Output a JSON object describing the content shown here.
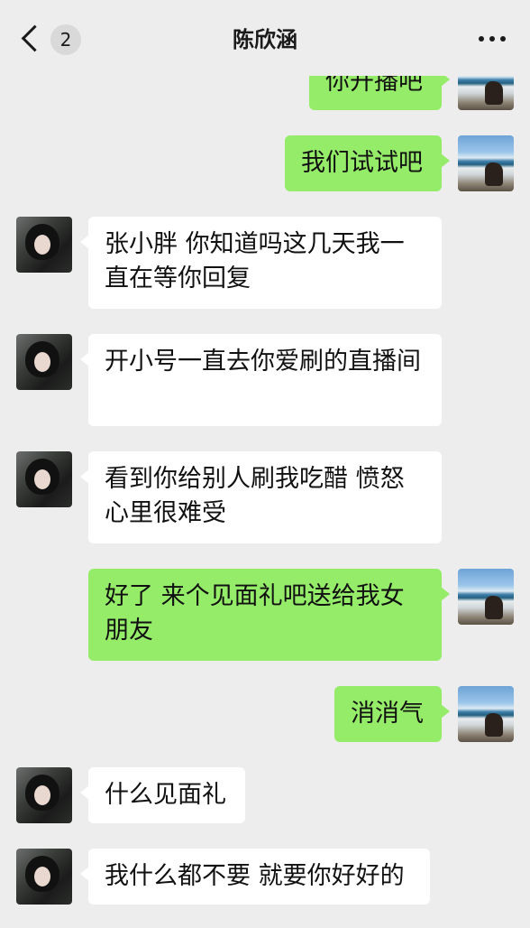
{
  "header": {
    "title": "陈欣涵",
    "unread_count": "2"
  },
  "messages": [
    {
      "from": "me",
      "text": "你开播吧"
    },
    {
      "from": "me",
      "text": "我们试试吧"
    },
    {
      "from": "her",
      "text": "张小胖 你知道吗这几天我一直在等你回复"
    },
    {
      "from": "her",
      "text": "开小号一直去你爱刷的直播间"
    },
    {
      "from": "her",
      "text": "看到你给别人刷我吃醋 愤怒心里很难受"
    },
    {
      "from": "me",
      "text": "好了 来个见面礼吧送给我女朋友"
    },
    {
      "from": "me",
      "text": "消消气"
    },
    {
      "from": "her",
      "text": "什么见面礼"
    },
    {
      "from": "her",
      "text": "我什么都不要 就要你好好的"
    }
  ],
  "colors": {
    "background": "#ededed",
    "sent_bubble": "#95ec69",
    "received_bubble": "#ffffff"
  }
}
